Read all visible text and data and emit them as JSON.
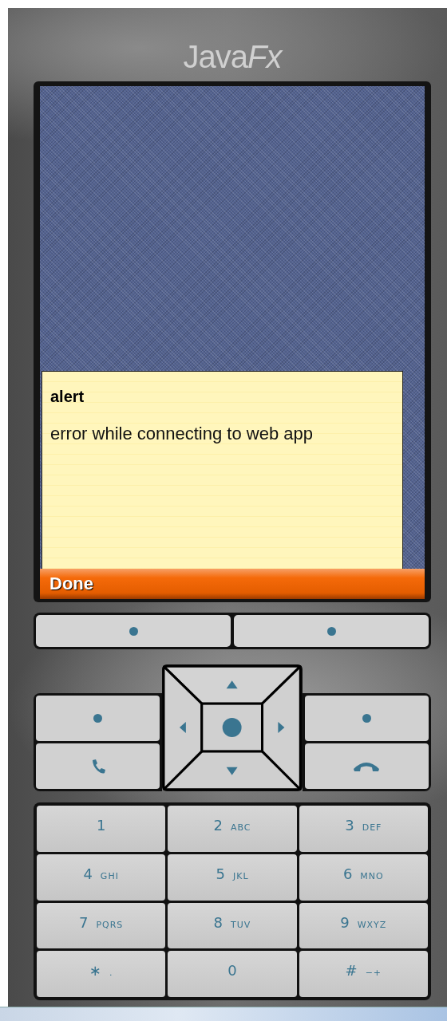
{
  "logo": {
    "plain": "Java",
    "italic": "Fx"
  },
  "alert": {
    "title": "alert",
    "message": "error while connecting to web app"
  },
  "command_bar": {
    "label": "Done"
  },
  "keypad": [
    {
      "digit": "1"
    },
    {
      "digit": "2",
      "letters": "ABC"
    },
    {
      "digit": "3",
      "letters": "DEF"
    },
    {
      "digit": "4",
      "letters": "GHI"
    },
    {
      "digit": "5",
      "letters": "JKL"
    },
    {
      "digit": "6",
      "letters": "MNO"
    },
    {
      "digit": "7",
      "letters": "PQRS"
    },
    {
      "digit": "8",
      "letters": "TUV"
    },
    {
      "digit": "9",
      "letters": "WXYZ"
    },
    {
      "digit": "∗",
      "letters": "."
    },
    {
      "digit": "0"
    },
    {
      "digit": "#",
      "letters": "−+"
    }
  ]
}
